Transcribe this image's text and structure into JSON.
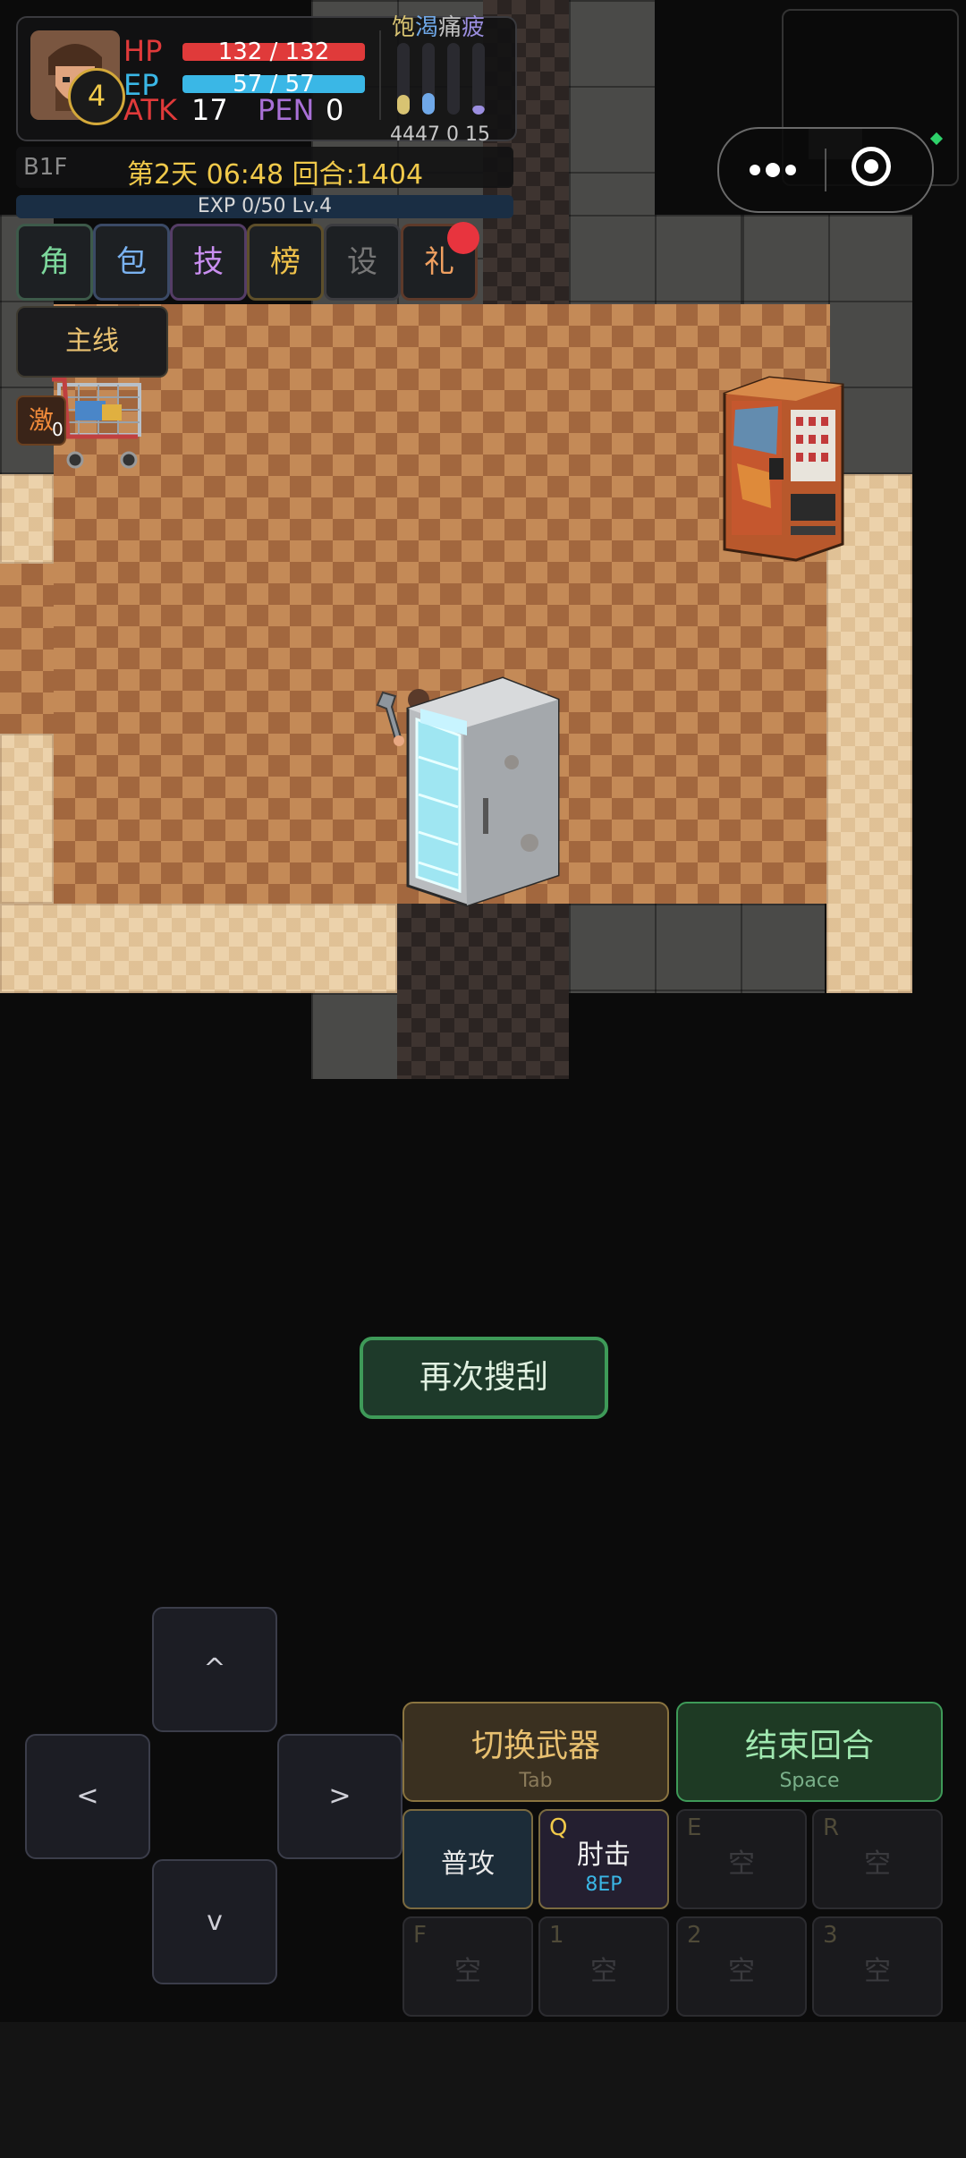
{
  "hud": {
    "level": "4",
    "hp_label": "HP",
    "hp_value": "132 / 132",
    "hp_fill": 1.0,
    "ep_label": "EP",
    "ep_value": "57 / 57",
    "ep_fill": 1.0,
    "atk_label": "ATK",
    "atk_value": "17",
    "pen_label": "PEN",
    "pen_value": "0",
    "status_labels": [
      "饱",
      "渴",
      "痛",
      "疲"
    ],
    "status_values_text": "4447 0 15",
    "status_levels": [
      0.28,
      0.3,
      0.0,
      0.12
    ],
    "status_colors": [
      "#d8c372",
      "#6fa8e8",
      "#7a7a7a",
      "#9b8ee0"
    ],
    "floor": "B1F",
    "day_time": "第2天 06:48 回合:1404",
    "exp_text": "EXP 0/50 Lv.4",
    "colors": {
      "hp": "#e03a3a",
      "ep": "#3ab7e6",
      "gold": "#f0c94a"
    }
  },
  "menu": {
    "buttons": [
      {
        "label": "角",
        "color": "#7dd89c"
      },
      {
        "label": "包",
        "color": "#7ab2f0"
      },
      {
        "label": "技",
        "color": "#c98ef0"
      },
      {
        "label": "榜",
        "color": "#f0c24a"
      },
      {
        "label": "设",
        "color": "#777777"
      },
      {
        "label": "礼",
        "color": "#f0a060"
      }
    ],
    "quest_button": "主线",
    "side_button": "激",
    "side_count": "0"
  },
  "scene": {
    "search_again_button": "再次搜刮"
  },
  "controls": {
    "dpad": {
      "up": "^",
      "left": "<",
      "right": ">",
      "down": "v"
    },
    "switch_weapon": {
      "label": "切换武器",
      "hint": "Tab"
    },
    "end_turn": {
      "label": "结束回合",
      "hint": "Space"
    },
    "skills_row1": [
      {
        "key": "",
        "name": "普攻",
        "cost": ""
      },
      {
        "key": "Q",
        "name": "肘击",
        "cost": "8EP"
      },
      {
        "key": "E",
        "name": "空",
        "cost": ""
      },
      {
        "key": "R",
        "name": "空",
        "cost": ""
      }
    ],
    "skills_row2": [
      {
        "key": "F",
        "name": "空"
      },
      {
        "key": "1",
        "name": "空"
      },
      {
        "key": "2",
        "name": "空"
      },
      {
        "key": "3",
        "name": "空"
      }
    ]
  }
}
